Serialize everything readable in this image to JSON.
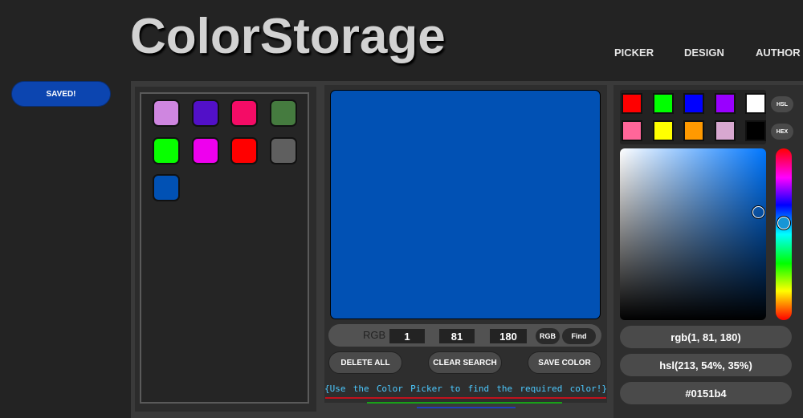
{
  "header": {
    "logo": "ColorStorage",
    "nav": [
      "PICKER",
      "DESIGN",
      "AUTHOR"
    ]
  },
  "status": {
    "saved_label": "SAVED!"
  },
  "saved_colors": [
    "#cf86e0",
    "#5210c8",
    "#f40c66",
    "#457b3f",
    "#08ff00",
    "#ee00ee",
    "#ff0000",
    "#5f5f5f",
    "#0151b4"
  ],
  "current_color": "#0151b4",
  "rgb_bar": {
    "label": "RGB",
    "r": "1",
    "g": "81",
    "b": "180",
    "mode_label": "RGB",
    "find_label": "Find"
  },
  "buttons": {
    "delete_all": "DELETE ALL",
    "clear_search": "CLEAR SEARCH",
    "save_color": "SAVE COLOR"
  },
  "hint_words": [
    "{Use",
    "the",
    "Color",
    "Picker",
    "to",
    "find",
    "the",
    "required",
    "color!}"
  ],
  "picker": {
    "presets": [
      "#ff0000",
      "#00ff00",
      "#0000ff",
      "#9900ff",
      "#ffffff",
      "#ff6699",
      "#ffff00",
      "#ff9900",
      "#d8a8d0",
      "#000000"
    ],
    "hsl_btn": "HSL",
    "hex_btn": "HEX",
    "rgb_value": "rgb(1, 81, 180)",
    "hsl_value": "hsl(213, 54%, 35%)",
    "hex_value": "#0151b4"
  }
}
